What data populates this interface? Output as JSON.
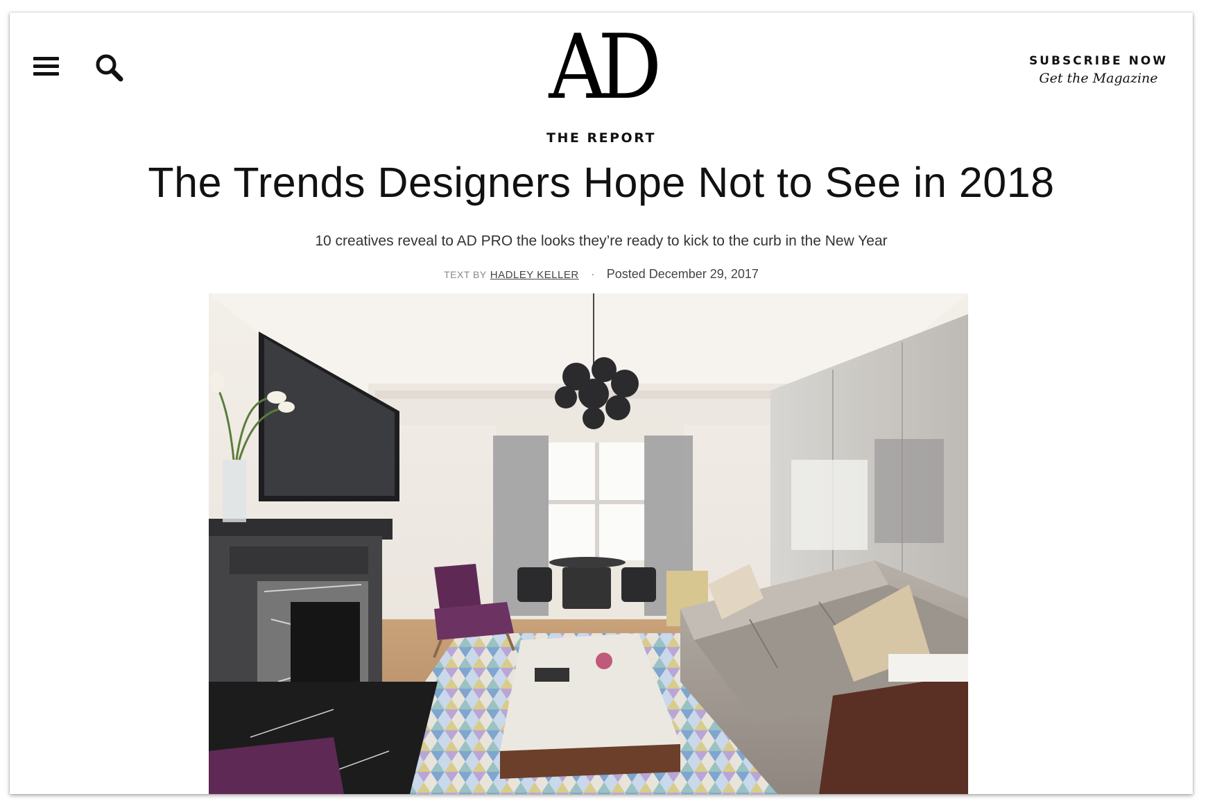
{
  "header": {
    "menu_icon": "hamburger-menu-icon",
    "search_icon": "search-icon",
    "logo_text": "AD",
    "subscribe_title": "SUBSCRIBE NOW",
    "subscribe_subtitle": "Get the Magazine"
  },
  "article": {
    "rubric": "THE REPORT",
    "headline": "The Trends Designers Hope Not to See in 2018",
    "dek": "10 creatives reveal to AD PRO the looks they’re ready to kick to the curb in the New Year",
    "byline_prefix": "TEXT BY",
    "author": "HADLEY KELLER",
    "separator": "·",
    "posted": "Posted December 29, 2017"
  },
  "colors": {
    "text": "#111111",
    "muted": "#888888",
    "velvet_purple": "#5e2a55",
    "sofa_taupe": "#a9a29a",
    "mantel_charcoal": "#3a3a3c"
  }
}
